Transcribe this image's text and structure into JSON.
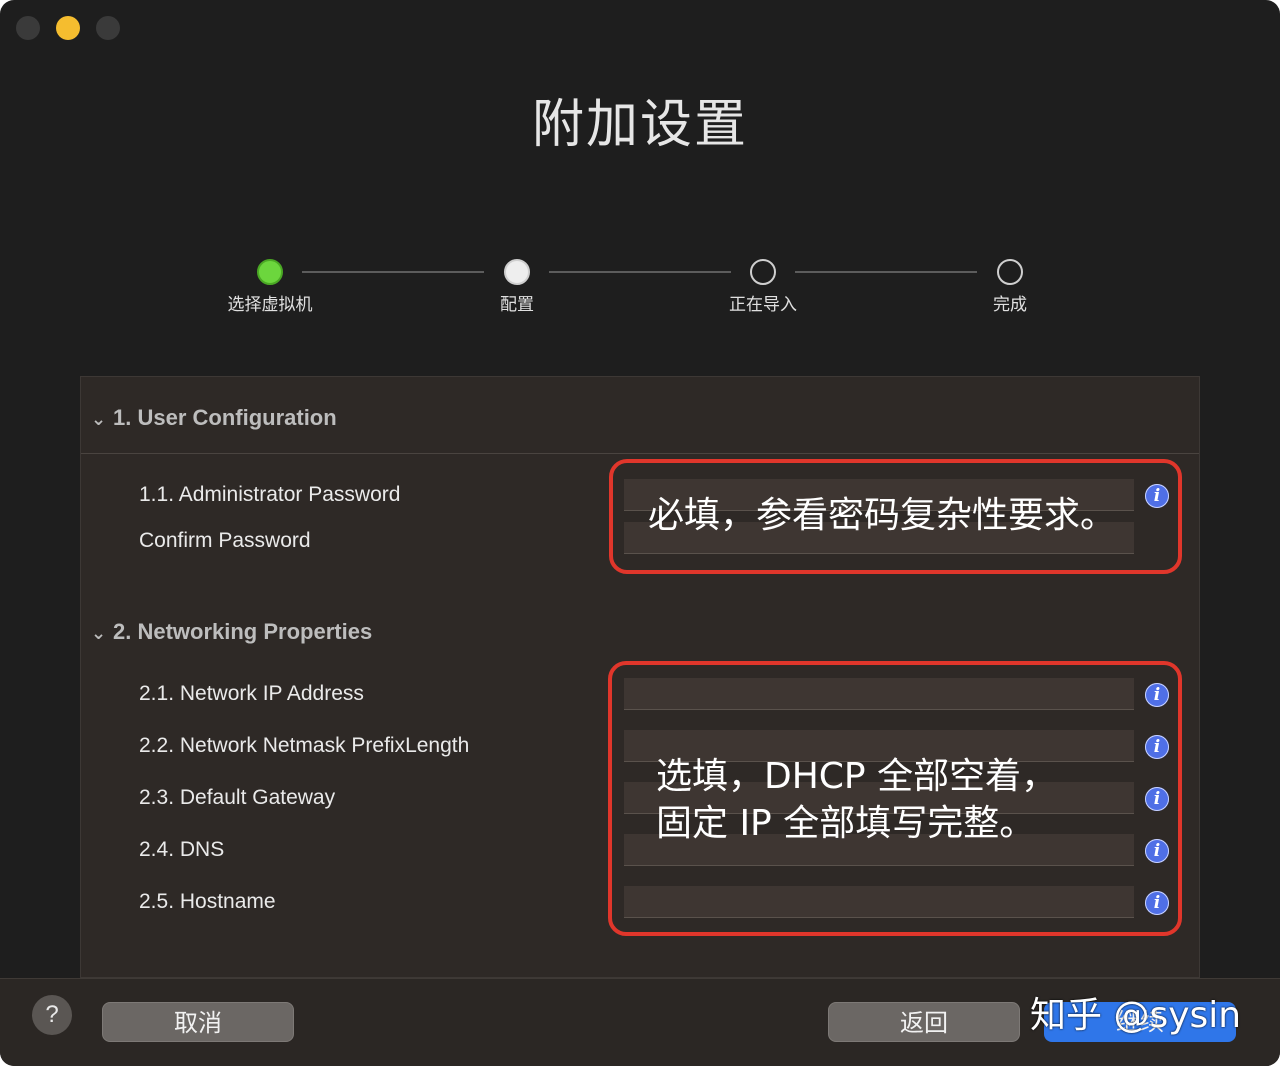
{
  "window": {
    "title": "附加设置"
  },
  "steps": [
    {
      "label": "选择虚拟机",
      "state": "done"
    },
    {
      "label": "配置",
      "state": "current"
    },
    {
      "label": "正在导入",
      "state": "todo"
    },
    {
      "label": "完成",
      "state": "todo"
    }
  ],
  "sections": {
    "user": {
      "header": "1. User Configuration",
      "fields": [
        {
          "label": "1.1. Administrator Password"
        },
        {
          "label": "Confirm Password"
        }
      ]
    },
    "network": {
      "header": "2. Networking Properties",
      "fields": [
        {
          "label": "2.1. Network IP Address"
        },
        {
          "label": "2.2. Network Netmask PrefixLength"
        },
        {
          "label": "2.3. Default Gateway"
        },
        {
          "label": "2.4. DNS"
        },
        {
          "label": "2.5. Hostname"
        }
      ]
    }
  },
  "annotations": {
    "password_note": "必填，参看密码复杂性要求。",
    "network_note_line1": "选填，DHCP 全部空着，",
    "network_note_line2": "固定 IP 全部填写完整。"
  },
  "icons": {
    "info": "i",
    "help": "?"
  },
  "buttons": {
    "cancel": "取消",
    "back": "返回",
    "continue": "继续"
  },
  "watermark": "知乎 @sysin",
  "colors": {
    "accent_blue": "#2f76e9",
    "step_done": "#6cd63d",
    "annotation_red": "#e0362b",
    "info_icon": "#4f6fe6"
  }
}
